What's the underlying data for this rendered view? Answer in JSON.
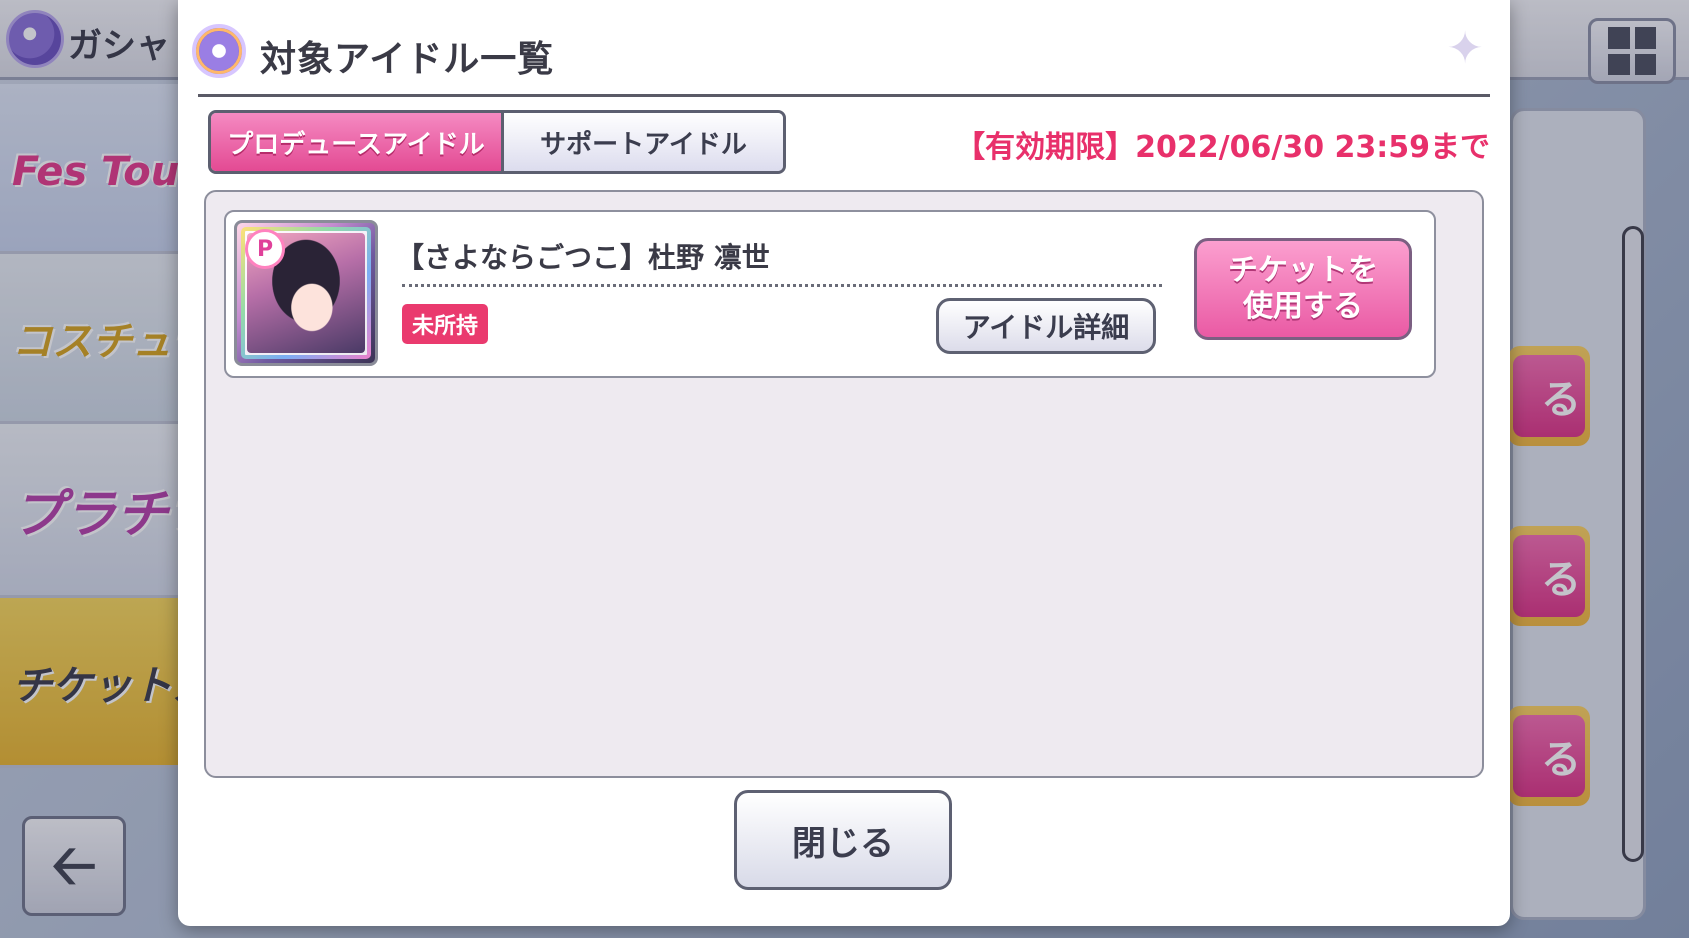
{
  "background": {
    "header_title": "ガシャ",
    "banners": [
      {
        "label": "Fes Tour ピックアップ"
      },
      {
        "label": "コスチューム ガシャ"
      },
      {
        "label": "プラチナ ガシャ"
      },
      {
        "label": "チケットガシャ"
      }
    ],
    "use_buttons": [
      "る",
      "る",
      "る"
    ]
  },
  "modal": {
    "title": "対象アイドル一覧",
    "tabs": [
      {
        "label": "プロデュースアイドル",
        "active": true
      },
      {
        "label": "サポートアイドル",
        "active": false
      }
    ],
    "expiry": "【有効期限】2022/06/30 23:59まで",
    "idols": [
      {
        "name": "【さよならごつこ】杜野 凛世",
        "status": "未所持",
        "type_badge": "P",
        "detail_label": "アイドル詳細",
        "use_ticket_label_line1": "チケットを",
        "use_ticket_label_line2": "使用する"
      }
    ],
    "close_label": "閉じる"
  },
  "colors": {
    "accent_pink": "#e34a93",
    "expiry_red": "#e8306b",
    "status_badge": "#ea3a6e"
  },
  "icons": {
    "modal_icon": "gasha-disc-icon",
    "sparkle": "sparkle-icon",
    "back": "back-arrow-icon",
    "grid_menu": "grid-menu-icon"
  }
}
